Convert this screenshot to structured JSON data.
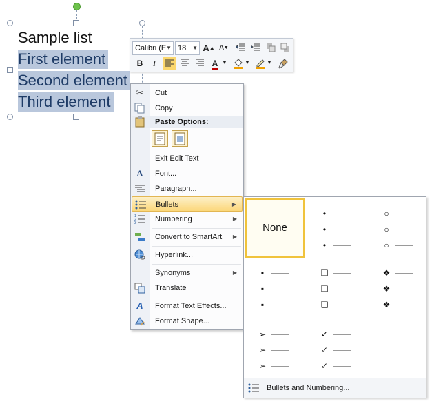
{
  "slide": {
    "lines": [
      "Sample list",
      "First element",
      "Second element",
      "Third element"
    ]
  },
  "mini_toolbar": {
    "font_name": "Calibri (E",
    "font_size": "18",
    "bold": "B",
    "italic": "I",
    "text_color": "#c00000",
    "highlight_color": "#f0a000"
  },
  "context_menu": {
    "cut": "Cut",
    "copy": "Copy",
    "paste_options": "Paste Options:",
    "exit_edit_text": "Exit Edit Text",
    "font": "Font...",
    "paragraph": "Paragraph...",
    "bullets": "Bullets",
    "numbering": "Numbering",
    "convert_smartart": "Convert to SmartArt",
    "hyperlink": "Hyperlink...",
    "synonyms": "Synonyms",
    "translate": "Translate",
    "format_text_effects": "Format Text Effects...",
    "format_shape": "Format Shape..."
  },
  "bullets_submenu": {
    "none_label": "None",
    "footer": "Bullets and Numbering...",
    "styles": [
      "none",
      "filled-round",
      "hollow-round",
      "filled-square",
      "hollow-square",
      "diamond-cross",
      "arrow",
      "checkmark"
    ],
    "symbols": {
      "filled_round": "•",
      "hollow_round": "○",
      "filled_square": "▪",
      "hollow_square": "❑",
      "diamond_cross": "❖",
      "arrow": "➢",
      "checkmark": "✓"
    }
  }
}
